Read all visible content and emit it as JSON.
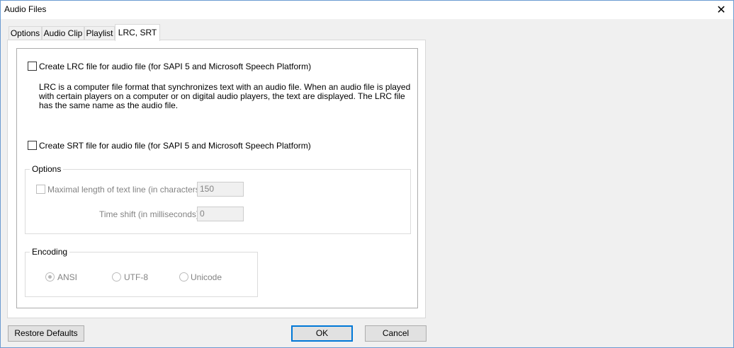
{
  "window": {
    "title": "Audio Files"
  },
  "tabs": [
    {
      "label": "Options"
    },
    {
      "label": "Audio Clip"
    },
    {
      "label": "Playlist"
    },
    {
      "label": "LRC, SRT"
    }
  ],
  "lrc": {
    "checkbox_label": "Create LRC file for audio file (for SAPI 5 and Microsoft Speech Platform)",
    "checked": false,
    "description": "LRC is a computer file format that synchronizes text with an audio file. When an audio file is played with certain players on a computer or on digital audio players, the text are displayed. The LRC file has the same name as the audio file."
  },
  "srt": {
    "checkbox_label": "Create SRT file for audio file (for SAPI 5 and Microsoft Speech Platform)",
    "checked": false
  },
  "options_group": {
    "title": "Options",
    "maxlen_label": "Maximal length of text line (in characters):",
    "maxlen_value": "150",
    "timeshift_label": "Time shift (in milliseconds):",
    "timeshift_value": "0"
  },
  "encoding_group": {
    "title": "Encoding",
    "options": [
      "ANSI",
      "UTF-8",
      "Unicode"
    ],
    "selected": "ANSI"
  },
  "buttons": {
    "restore": "Restore Defaults",
    "ok": "OK",
    "cancel": "Cancel"
  },
  "colors": {
    "accent": "#0078d7",
    "window_border": "#6b9bd1",
    "disabled_text": "#838383"
  }
}
